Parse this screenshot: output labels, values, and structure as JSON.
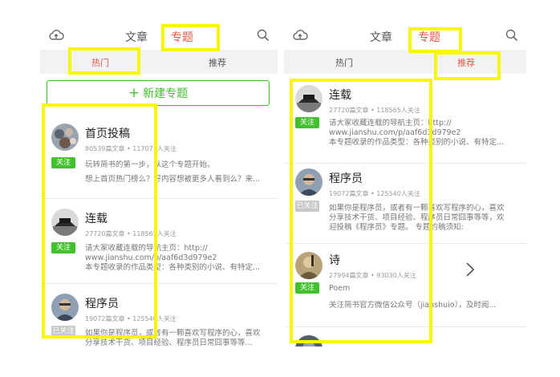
{
  "left": {
    "tabs": {
      "articles": "文章",
      "topics": "专题"
    },
    "subtabs": {
      "hot": "热门",
      "recommended": "推荐"
    },
    "new_topic": {
      "plus": "+",
      "label": "新建专题"
    },
    "items": [
      {
        "title": "首页投稿",
        "meta": "80539篇文章 • 117071人关注",
        "follow": "关注",
        "desc": [
          "玩转简书的第一步，从这个专题开始。",
          "想上首页热门榜么？好内容想被更多人看到么？来..."
        ]
      },
      {
        "title": "连载",
        "meta": "27720篇文章 • 118565人关注",
        "follow": "关注",
        "desc": [
          "请大家收藏连载的导航主页：http://",
          "www.jianshu.com/p/aaf6d3d979e2",
          "本专题收录的作品类型：各种类别的小说、有特定..."
        ]
      },
      {
        "title": "程序员",
        "meta": "19072篇文章 • 125540人关注",
        "follow": "已关注",
        "desc": [
          "如果你是程序员，或者有一颗喜欢写程序的心，喜欢",
          "分享技术干货、项目经验、程序员日常囧事等等..."
        ]
      }
    ]
  },
  "right": {
    "tabs": {
      "articles": "文章",
      "topics": "专题"
    },
    "subtabs": {
      "hot": "热门",
      "recommended": "推荐"
    },
    "items": [
      {
        "title": "连载",
        "meta": "27720篇文章 • 118565人关注",
        "follow": "关注",
        "desc": [
          "请大家收藏连载的导航主页：http://",
          "www.jianshu.com/p/aaf6d3d979e2",
          "本专题收录的作品类型：各种类别的小说、有特定..."
        ]
      },
      {
        "title": "程序员",
        "meta": "19072篇文章 • 125540人关注",
        "follow": "已关注",
        "desc": [
          "如果你是程序员，或者有一颗喜欢写程序的心，喜欢",
          "分享技术干货、项目经验、程序员日常囧事等等，欢",
          "迎投稿《程序员》专题。 专题约稿须知:"
        ]
      },
      {
        "title": "诗",
        "meta": "27994篇文章 • 93030人关注",
        "follow": "关注",
        "desc": [
          "Poem",
          "关注简书官方微信公众号（jianshuio），及时阅..."
        ]
      }
    ]
  },
  "colors": {
    "accent_green": "#42c02e",
    "active_red": "#e05a4a",
    "highlight_yellow": "#f7f702"
  },
  "icons": [
    "upload-cloud-icon",
    "search-icon",
    "plus-icon",
    "chevron-right-icon"
  ]
}
